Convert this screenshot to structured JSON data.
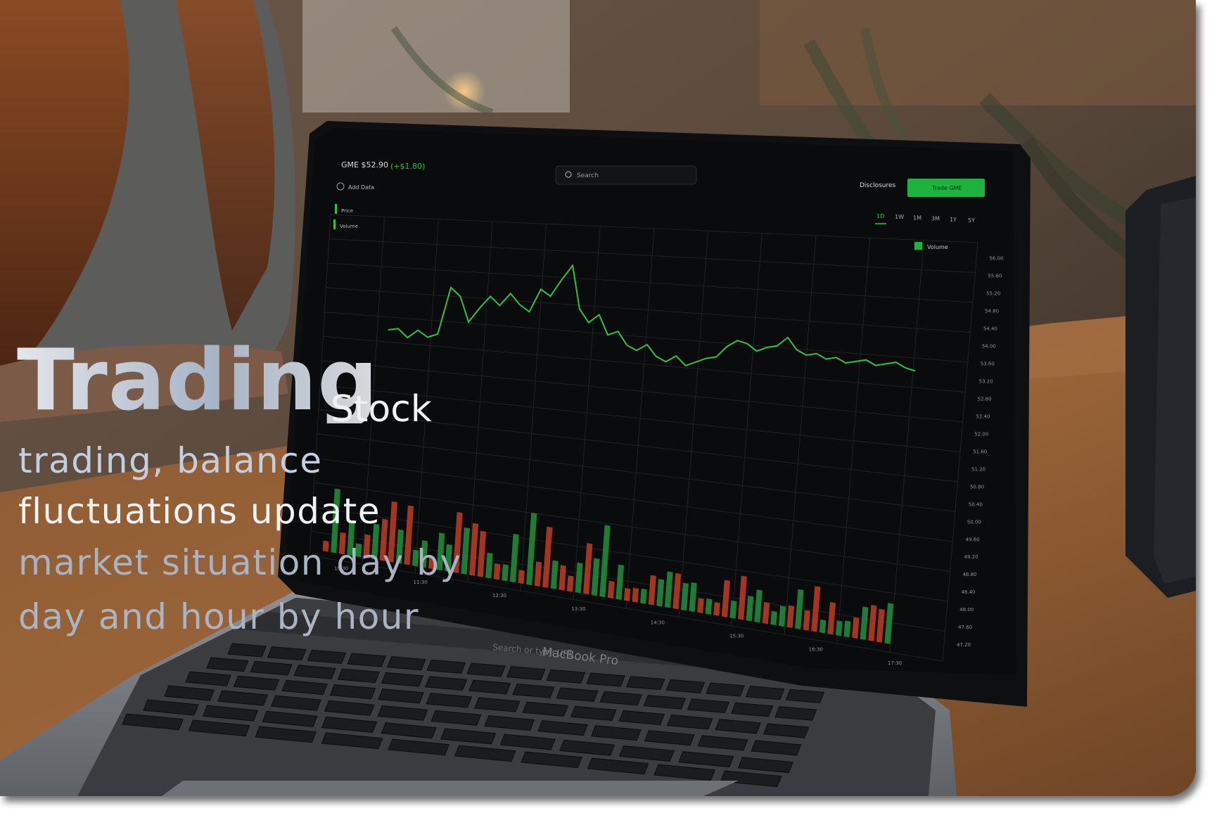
{
  "photo": {
    "screen": {
      "ticker_label": "GME $52.90",
      "change_label": "(+$1.80)",
      "search_placeholder": "Search",
      "add_data_label": "Add Data",
      "legend": [
        "Price",
        "Volume"
      ],
      "disclosures_label": "Disclosures",
      "trade_button_label": "Trade GME",
      "timeframes": [
        "1D",
        "1W",
        "1M",
        "3M",
        "1Y",
        "5Y"
      ],
      "volume_toggle_label": "Volume",
      "y_axis_ticks": [
        "56.00",
        "55.60",
        "55.20",
        "54.80",
        "54.40",
        "54.00",
        "53.60",
        "53.20",
        "52.80",
        "52.40",
        "52.00",
        "51.60",
        "51.20",
        "50.80",
        "50.40",
        "50.00",
        "49.60",
        "49.20",
        "48.80",
        "48.40",
        "48.00",
        "47.60",
        "47.20"
      ],
      "x_axis_ticks": [
        "10:30",
        "11:30",
        "12:30",
        "13:30",
        "14:30",
        "15:30",
        "16:30",
        "17:30"
      ],
      "price_series": [
        51.8,
        51.9,
        51.5,
        51.9,
        51.6,
        51.8,
        54.1,
        53.7,
        52.5,
        53.2,
        53.8,
        53.4,
        54.0,
        53.5,
        53.2,
        54.3,
        54.0,
        54.8,
        55.5,
        53.5,
        52.9,
        53.3,
        52.4,
        52.6,
        52.0,
        51.8,
        52.1,
        51.6,
        51.4,
        51.7,
        51.3,
        51.5,
        51.7,
        51.8,
        52.3,
        52.6,
        52.5,
        52.2,
        52.4,
        52.5,
        52.9,
        52.4,
        52.2,
        52.3,
        52.1,
        52.2,
        52.0,
        52.1,
        52.2,
        52.0,
        52.1,
        52.2,
        52.0,
        51.9
      ],
      "line_color": "#2ec24a",
      "up_volume_color": "#1f8a3a",
      "down_volume_color": "#b83a22",
      "trade_button_color": "#1db33f"
    },
    "laptop_label": "MacBook Pro",
    "touch_bar_placeholder": "Search or type URL"
  },
  "overlay": {
    "headline": "Trading",
    "subheadline": "Stock",
    "tagline_lines": [
      "trading, balance",
      "fluctuations update",
      "market situation day by",
      "day and hour by hour"
    ]
  }
}
